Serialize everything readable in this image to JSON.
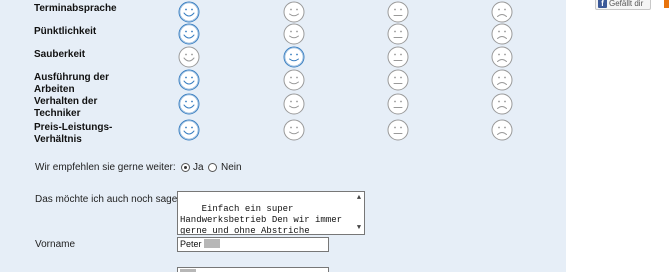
{
  "criteria": [
    {
      "label": "Terminabsprache",
      "selected": 0
    },
    {
      "label": "Pünktlichkeit",
      "selected": 0
    },
    {
      "label": "Sauberkeit",
      "selected": 1
    },
    {
      "label": "Ausführung der Arbeiten",
      "selected": 0
    },
    {
      "label": "Verhalten der Techniker",
      "selected": 0
    },
    {
      "label": "Preis-Leistungs-Verhältnis",
      "selected": 0
    }
  ],
  "rating_scale": [
    "very-happy-face-icon",
    "happy-face-icon",
    "neutral-face-icon",
    "sad-face-icon"
  ],
  "colors": {
    "panel": "#e6eef7",
    "selected_smiley": "#3a7fc1",
    "unselected_smiley": "#9a9a9a",
    "accent": "#e8730c",
    "facebook": "#3b5998"
  },
  "recommend": {
    "label": "Wir empfehlen sie gerne weiter:",
    "yes": "Ja",
    "no": "Nein",
    "selected": "yes"
  },
  "comment": {
    "label": "Das möchte ich auch noch sagen :",
    "value": "Einfach ein super Handwerksbetrieb Den wir immer gerne und ohne Abstriche weiterempfehlen"
  },
  "firstname": {
    "label": "Vorname",
    "value": "Peter"
  },
  "facebook": {
    "label": "Gefällt dir"
  }
}
